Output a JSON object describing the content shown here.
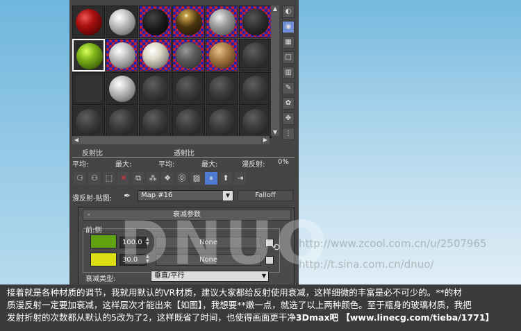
{
  "meters": {
    "reflect_ratio": "反射比",
    "transmit_ratio": "透射比",
    "avg1": "平均:",
    "max1": "最大:",
    "avg2": "平均:",
    "max2": "最大:",
    "diffuse": "漫反射:",
    "diffuse_val": "0%"
  },
  "map": {
    "label": "漫反射-贴图:",
    "value": "Map #16",
    "type": "Falloff"
  },
  "rollout": {
    "minus": "-",
    "title": "衰减参数",
    "frontside": "前:侧",
    "row1": {
      "amount": "100.0",
      "map": "None",
      "color": "#5fa30e"
    },
    "row2": {
      "amount": "30.0",
      "map": "None",
      "color": "#dede14"
    },
    "falloff_type_label": "衰减类型:",
    "falloff_type_value": "垂直/平行"
  },
  "watermark": {
    "logo": "DNUO",
    "url1": "http://www.zcool.com.cn/u/2507965",
    "url2": "http://t.sina.com.cn/dnuo/"
  },
  "caption": {
    "line1": "接着就是各种材质的调节，我就用默认的VR材质，建议大家都给反射使用衰减，这样细微的丰富是必不可少的。**的材",
    "line2": "质漫反射一定要加衰减，这样层次才能出来【如图】，我想要**嫩一点，就选了以上两种颜色。至于瓶身的玻璃材质，我把",
    "line3_pre": "发射折射的次数都从默认的5改为了2，这样既省了时间，也使得画面更干净",
    "line3_credit": "3Dmax吧 【www.linecg.com/tieba/1771】"
  },
  "colors": {
    "accent_blue": "#4f7bd2",
    "panel": "#444444",
    "caption_bg": "#3b3b3b"
  }
}
